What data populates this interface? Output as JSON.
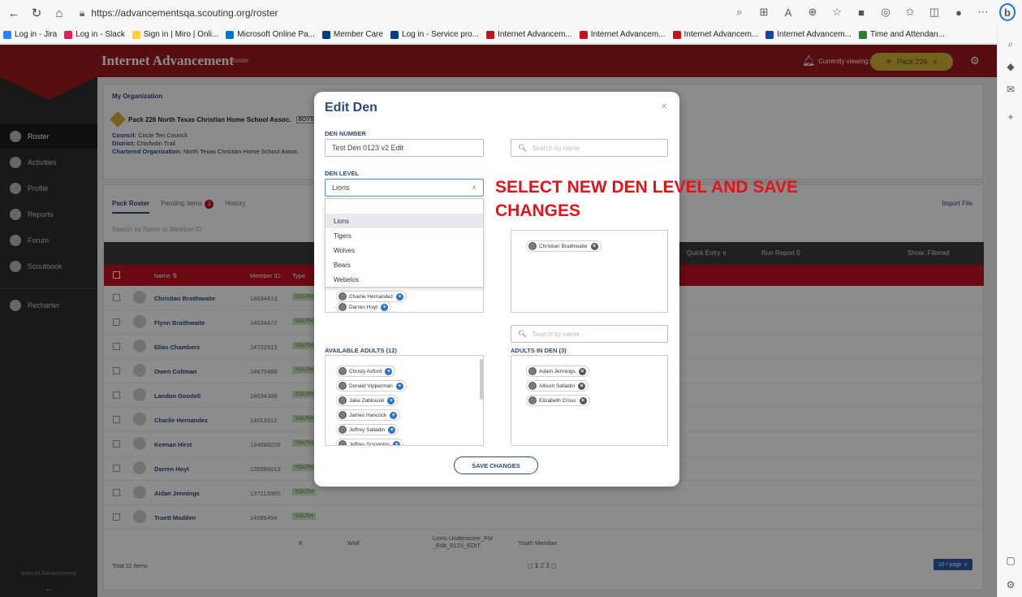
{
  "browser": {
    "url": "https://advancementsqa.scouting.org/roster",
    "bookmarks": [
      {
        "label": "Log in - Jira",
        "color": "#2684ff"
      },
      {
        "label": "Log in - Slack",
        "color": "#e01e5a"
      },
      {
        "label": "Sign in | Miro | Onli...",
        "color": "#ffd02f"
      },
      {
        "label": "Microsoft Online Pa...",
        "color": "#0078d4"
      },
      {
        "label": "Member Care",
        "color": "#003f87"
      },
      {
        "label": "Log in - Service pro...",
        "color": "#003f87"
      },
      {
        "label": "Internet Advancem...",
        "color": "#c1121f"
      },
      {
        "label": "Internet Advancem...",
        "color": "#c1121f"
      },
      {
        "label": "Internet Advancem...",
        "color": "#c1121f"
      },
      {
        "label": "Internet Advancem...",
        "color": "#0d47a1"
      },
      {
        "label": "Time and Attendan...",
        "color": "#2e7d32"
      }
    ]
  },
  "app": {
    "title": "Internet Advancement",
    "subtitle": "Roster",
    "currently_viewing_label": "Currently viewing:",
    "current_pack": "Pack 226",
    "brand_color": "#9e1b20",
    "sidebar": [
      {
        "label": "Roster",
        "icon": "roster-icon"
      },
      {
        "label": "Activities",
        "icon": "activities-icon"
      },
      {
        "label": "Profile",
        "icon": "profile-icon"
      },
      {
        "label": "Reports",
        "icon": "reports-icon"
      },
      {
        "label": "Forum",
        "icon": "forum-icon"
      },
      {
        "label": "Scoutbook",
        "icon": "scoutbook-icon"
      },
      {
        "label": "Recharter",
        "icon": "recharter-icon"
      }
    ],
    "sidebar_footer": "Internet Advancement"
  },
  "org": {
    "section_title": "My Organization",
    "pack_name": "Pack 226 North Texas Christian Home School Assoc.",
    "pack_tag": "BOYS",
    "council_label": "Council:",
    "council_value": "Circle Ten Council",
    "district_label": "District:",
    "district_value": "Chisholm Trail",
    "chartered_label": "Chartered Organization:",
    "chartered_value": "North Texas Christian Home School Assoc."
  },
  "roster": {
    "tabs": [
      "Pack Roster",
      "Pending Items",
      "History"
    ],
    "pending_count": "1",
    "import_label": "Import File",
    "search_placeholder": "Search by Name or Member ID",
    "toolbar": {
      "quick_entry": "Quick Entry ∨",
      "run_report": "Run Report",
      "run_report_count": "0",
      "show": "Show: Filtered"
    },
    "columns": {
      "name": "Name ⇅",
      "member_id": "Member ID",
      "type": "Type"
    },
    "rows": [
      {
        "name": "Christian Braithwaite",
        "id": "14634413",
        "type": "YOUTH"
      },
      {
        "name": "Flynn Braithwaite",
        "id": "14634472",
        "type": "YOUTH"
      },
      {
        "name": "Elias Chambers",
        "id": "14722513",
        "type": "YOUTH"
      },
      {
        "name": "Owen Coltman",
        "id": "14679488",
        "type": "YOUTH"
      },
      {
        "name": "Landon Goodell",
        "id": "14634388",
        "type": "YOUTH"
      },
      {
        "name": "Charlie Hernandez",
        "id": "14013912",
        "type": "YOUTH"
      },
      {
        "name": "Keenan Hirst",
        "id": "134888226",
        "type": "YOUTH"
      },
      {
        "name": "Darren Hoyt",
        "id": "135566013",
        "type": "YOUTH"
      },
      {
        "name": "Aidan Jennings",
        "id": "137113365",
        "type": "YOUTH"
      },
      {
        "name": "Truett Madden",
        "id": "14086494",
        "type": "YOUTH"
      }
    ],
    "last_row_grade": "8",
    "last_row_rank": "Wolf",
    "last_row_den": "Lions Underscore_For _Edit_0123_EDIT",
    "last_row_position": "Youth Member",
    "total": "Total 22 Items",
    "pages": [
      "1",
      "2",
      "3"
    ],
    "per_page": "10 / page ∨"
  },
  "modal": {
    "title": "Edit Den",
    "den_number_label": "DEN NUMBER",
    "den_number_value": "Test Den 0123 v2 Edit",
    "den_level_label": "DEN LEVEL",
    "den_level_value": "Lions",
    "search_placeholder": "Search by name",
    "level_options": [
      "Lions",
      "Tigers",
      "Wolves",
      "Bears",
      "Webelos"
    ],
    "selected_option_index": 0,
    "scouts_in_den": [
      "Christian Braithwaite"
    ],
    "available_scouts_visible": [
      "Charlie Hernandez",
      "Darren Hoyt"
    ],
    "available_adults_label": "AVAILABLE ADULTS (12)",
    "adults_in_den_label": "ADULTS IN DEN (3)",
    "available_adults": [
      "Christy Axford",
      "Donald Vipperman",
      "Jake Zablouski",
      "James Hancock",
      "Jeffrey Salladin",
      "Jeffrey Scroggins"
    ],
    "adults_in_den": [
      "Adam Jennings",
      "Allison Salladin",
      "Elizabeth Cross"
    ],
    "save_label": "SAVE CHANGES"
  },
  "annotation": "SELECT NEW DEN LEVEL AND SAVE CHANGES"
}
